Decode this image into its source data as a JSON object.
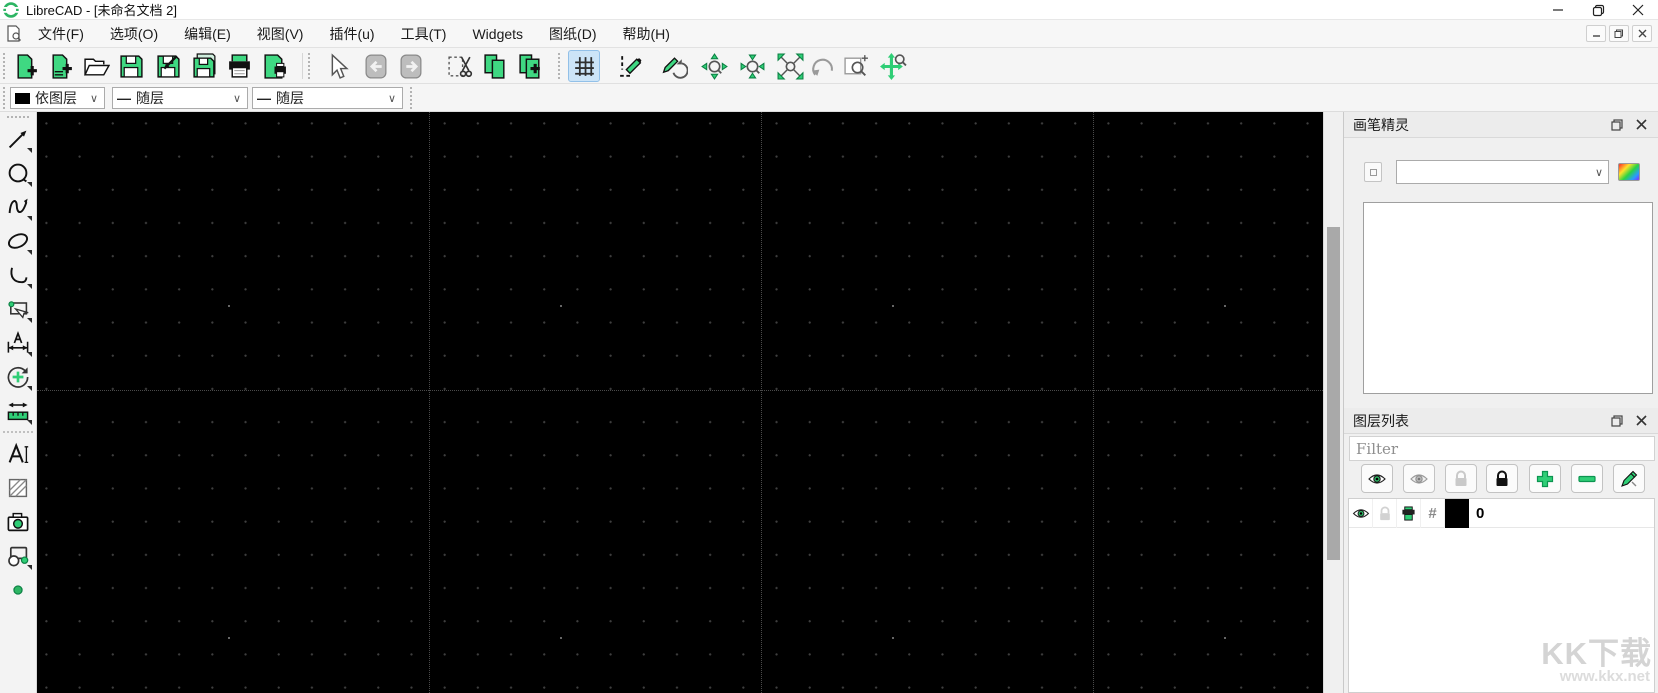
{
  "window": {
    "title": "LibreCAD - [未命名文档 2]"
  },
  "icons": {
    "chevron_down": "∨",
    "dash": "—",
    "hash": "#"
  },
  "menu": {
    "items": [
      "文件(F)",
      "选项(O)",
      "编辑(E)",
      "视图(V)",
      "插件(u)",
      "工具(T)",
      "Widgets",
      "图纸(D)",
      "帮助(H)"
    ]
  },
  "toolbar": {
    "pen_color": "依图层",
    "pen_width": "随层",
    "pen_linetype": "随层"
  },
  "panels": {
    "pen_wizard": {
      "title": "画笔精灵"
    },
    "layer_list": {
      "title": "图层列表",
      "filter_placeholder": "Filter",
      "layers": [
        {
          "name": "0"
        }
      ]
    }
  },
  "watermark": {
    "line1": "KK下载",
    "line2": "www.kkx.net"
  },
  "colors": {
    "accent_green": "#3fd882",
    "canvas": "#000000",
    "active_tool_bg": "#cce4f7"
  }
}
